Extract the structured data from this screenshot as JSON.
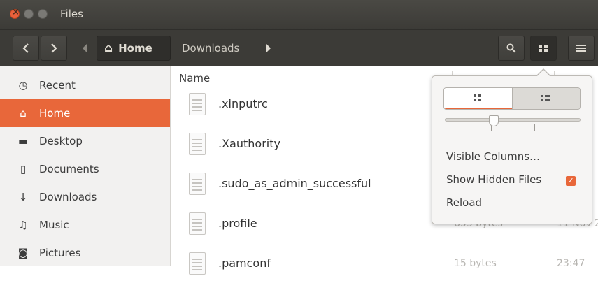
{
  "window": {
    "title": "Files"
  },
  "toolbar": {
    "back_icon": "chevron-left-icon",
    "forward_icon": "chevron-right-icon",
    "breadcrumbs": [
      "Home",
      "Downloads"
    ],
    "search_icon": "search-icon",
    "view_icon": "grid-view-icon",
    "menu_icon": "hamburger-menu-icon"
  },
  "sidebar": {
    "items": [
      {
        "label": "Recent",
        "icon": "clock-icon",
        "glyph": "◷"
      },
      {
        "label": "Home",
        "icon": "home-icon",
        "glyph": "⌂"
      },
      {
        "label": "Desktop",
        "icon": "folder-icon",
        "glyph": "▬"
      },
      {
        "label": "Documents",
        "icon": "document-icon",
        "glyph": "▯"
      },
      {
        "label": "Downloads",
        "icon": "download-icon",
        "glyph": "↓"
      },
      {
        "label": "Music",
        "icon": "music-icon",
        "glyph": "♫"
      },
      {
        "label": "Pictures",
        "icon": "camera-icon",
        "glyph": "◙"
      }
    ],
    "active": "Home"
  },
  "list": {
    "header": {
      "name": "Name"
    },
    "rows": [
      {
        "name": ".xinputrc",
        "size": "",
        "date": ""
      },
      {
        "name": ".Xauthority",
        "size": "",
        "date": ""
      },
      {
        "name": ".sudo_as_admin_successful",
        "size": "",
        "date": ""
      },
      {
        "name": ".profile",
        "size": "655 bytes",
        "date": "11 Nov 2017"
      },
      {
        "name": ".pamconf",
        "size": "15 bytes",
        "date": "23:47"
      }
    ]
  },
  "popover": {
    "view_modes": [
      "grid-view-icon",
      "list-view-icon"
    ],
    "active_view": "grid",
    "zoom_level": 0.35,
    "items": [
      {
        "label": "Visible Columns…"
      },
      {
        "label": "Show Hidden Files",
        "checked": true
      },
      {
        "label": "Reload"
      }
    ]
  },
  "colors": {
    "accent": "#e8673a",
    "titlebar": "#3c3b37",
    "sidebar": "#f2f1f0"
  }
}
